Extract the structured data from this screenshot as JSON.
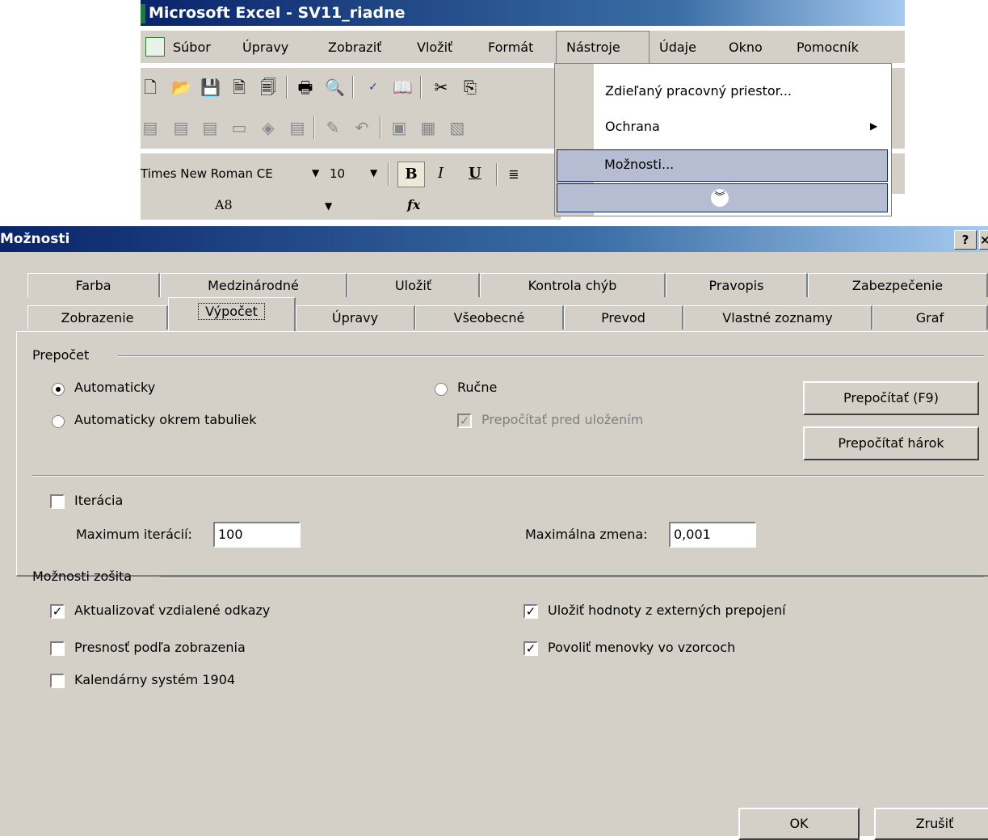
{
  "excel": {
    "title": "Microsoft Excel - SV11_riadne",
    "menu": [
      "Súbor",
      "Úpravy",
      "Zobraziť",
      "Vložiť",
      "Formát",
      "Nástroje",
      "Údaje",
      "Okno",
      "Pomocník"
    ],
    "font_name": "Times New Roman CE",
    "font_size": "10",
    "bold": "B",
    "italic": "I",
    "underline": "U",
    "cell_ref": "A8",
    "fx": "fx"
  },
  "tools_menu": {
    "items": [
      "Zdieľaný pracovný priestor...",
      "Ochrana",
      "Možnosti..."
    ],
    "expand_icon": "chevron-double-down-icon"
  },
  "dialog": {
    "title": "Možnosti",
    "help": "?",
    "tabs_row1": [
      "Farba",
      "Medzinárodné",
      "Uložiť",
      "Kontrola chýb",
      "Pravopis",
      "Zabezpečenie"
    ],
    "tabs_row2": [
      "Zobrazenie",
      "Výpočet",
      "Úpravy",
      "Všeobecné",
      "Prevod",
      "Vlastné zoznamy",
      "Graf"
    ],
    "active_tab": "Výpočet",
    "recalc": {
      "group": "Prepočet",
      "automatic": "Automaticky",
      "automatic_except_tables": "Automaticky okrem tabuliek",
      "manual": "Ručne",
      "recalc_before_save": "Prepočítať pred uložením",
      "calc_now_button": "Prepočítať (F9)",
      "calc_sheet_button": "Prepočítať hárok"
    },
    "iteration": {
      "label": "Iterácia",
      "max_iterations_label": "Maximum iterácií:",
      "max_iterations_value": "100",
      "max_change_label": "Maximálna zmena:",
      "max_change_value": "0,001"
    },
    "workbook": {
      "group": "Možnosti zošita",
      "update_remote_refs": "Aktualizovať vzdialené odkazy",
      "precision_as_displayed": "Presnosť podľa zobrazenia",
      "date_1904": "Kalendárny systém 1904",
      "save_external_values": "Uložiť hodnoty z externých prepojení",
      "accept_labels": "Povoliť menovky vo vzorcoch"
    },
    "ok": "OK",
    "cancel": "Zrušiť"
  }
}
